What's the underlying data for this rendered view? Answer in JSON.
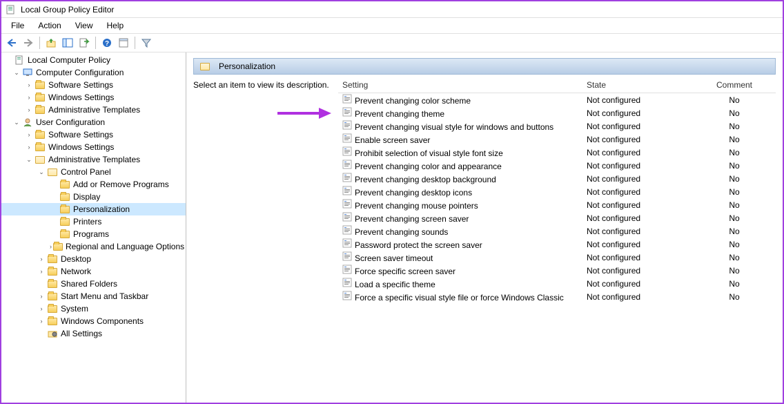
{
  "window": {
    "title": "Local Group Policy Editor"
  },
  "menubar": [
    "File",
    "Action",
    "View",
    "Help"
  ],
  "tree": {
    "root": "Local Computer Policy",
    "cc": "Computer Configuration",
    "cc_children": [
      "Software Settings",
      "Windows Settings",
      "Administrative Templates"
    ],
    "uc": "User Configuration",
    "uc_sw": "Software Settings",
    "uc_ws": "Windows Settings",
    "uc_at": "Administrative Templates",
    "cp": "Control Panel",
    "cp_children": [
      "Add or Remove Programs",
      "Display",
      "Personalization",
      "Printers",
      "Programs",
      "Regional and Language Options"
    ],
    "at_other": [
      "Desktop",
      "Network",
      "Shared Folders",
      "Start Menu and Taskbar",
      "System",
      "Windows Components",
      "All Settings"
    ]
  },
  "content": {
    "header": "Personalization",
    "description": "Select an item to view its description.",
    "columns": {
      "setting": "Setting",
      "state": "State",
      "comment": "Comment"
    },
    "rows": [
      {
        "setting": "Prevent changing color scheme",
        "state": "Not configured",
        "comment": "No"
      },
      {
        "setting": "Prevent changing theme",
        "state": "Not configured",
        "comment": "No"
      },
      {
        "setting": "Prevent changing visual style for windows and buttons",
        "state": "Not configured",
        "comment": "No"
      },
      {
        "setting": "Enable screen saver",
        "state": "Not configured",
        "comment": "No"
      },
      {
        "setting": "Prohibit selection of visual style font size",
        "state": "Not configured",
        "comment": "No"
      },
      {
        "setting": "Prevent changing color and appearance",
        "state": "Not configured",
        "comment": "No"
      },
      {
        "setting": "Prevent changing desktop background",
        "state": "Not configured",
        "comment": "No"
      },
      {
        "setting": "Prevent changing desktop icons",
        "state": "Not configured",
        "comment": "No"
      },
      {
        "setting": "Prevent changing mouse pointers",
        "state": "Not configured",
        "comment": "No"
      },
      {
        "setting": "Prevent changing screen saver",
        "state": "Not configured",
        "comment": "No"
      },
      {
        "setting": "Prevent changing sounds",
        "state": "Not configured",
        "comment": "No"
      },
      {
        "setting": "Password protect the screen saver",
        "state": "Not configured",
        "comment": "No"
      },
      {
        "setting": "Screen saver timeout",
        "state": "Not configured",
        "comment": "No"
      },
      {
        "setting": "Force specific screen saver",
        "state": "Not configured",
        "comment": "No"
      },
      {
        "setting": "Load a specific theme",
        "state": "Not configured",
        "comment": "No"
      },
      {
        "setting": "Force a specific visual style file or force Windows Classic",
        "state": "Not configured",
        "comment": "No"
      }
    ]
  }
}
